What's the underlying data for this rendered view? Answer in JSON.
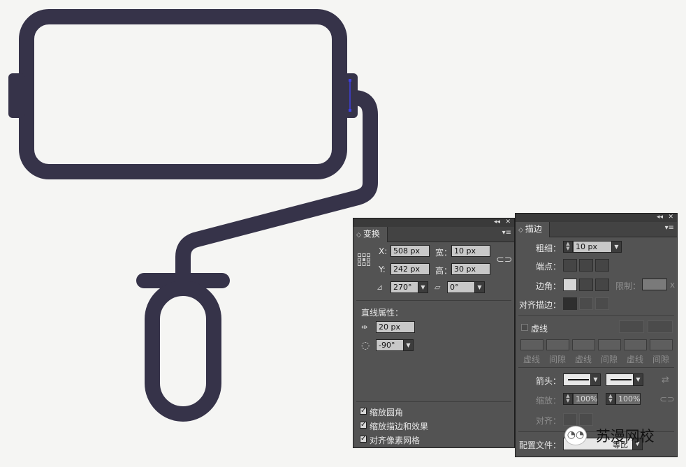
{
  "colors": {
    "shape": "#363349",
    "selection": "#3f3fe0",
    "panel_bg": "#535353"
  },
  "transform": {
    "tab": "变换",
    "x_label": "X:",
    "x_value": "508 px",
    "w_label": "宽：",
    "w_value": "10 px",
    "y_label": "Y:",
    "y_value": "242 px",
    "h_label": "高：",
    "h_value": "30 px",
    "rotate_value": "270°",
    "shear_value": "0°",
    "line_props": "直线属性：",
    "length_value": "20 px",
    "angle_value": "-90°",
    "opt1": "缩放圆角",
    "opt2": "缩放描边和效果",
    "opt3": "对齐像素网格"
  },
  "stroke": {
    "tab": "描边",
    "weight_label": "粗细：",
    "weight_value": "10 px",
    "cap_label": "端点：",
    "corner_label": "边角：",
    "limit_label": "限制：",
    "limit_unit": "x",
    "align_label": "对齐描边：",
    "dashed_label": "虚线",
    "dash_labels": [
      "虚线",
      "间隙",
      "虚线",
      "间隙",
      "虚线",
      "间隙"
    ],
    "arrow_label": "箭头：",
    "scale_label": "缩放：",
    "scale1": "100%",
    "scale2": "100%",
    "align2_label": "对齐：",
    "profile_label": "配置文件：",
    "profile_value": "等比"
  },
  "watermark": "苏漫网校"
}
